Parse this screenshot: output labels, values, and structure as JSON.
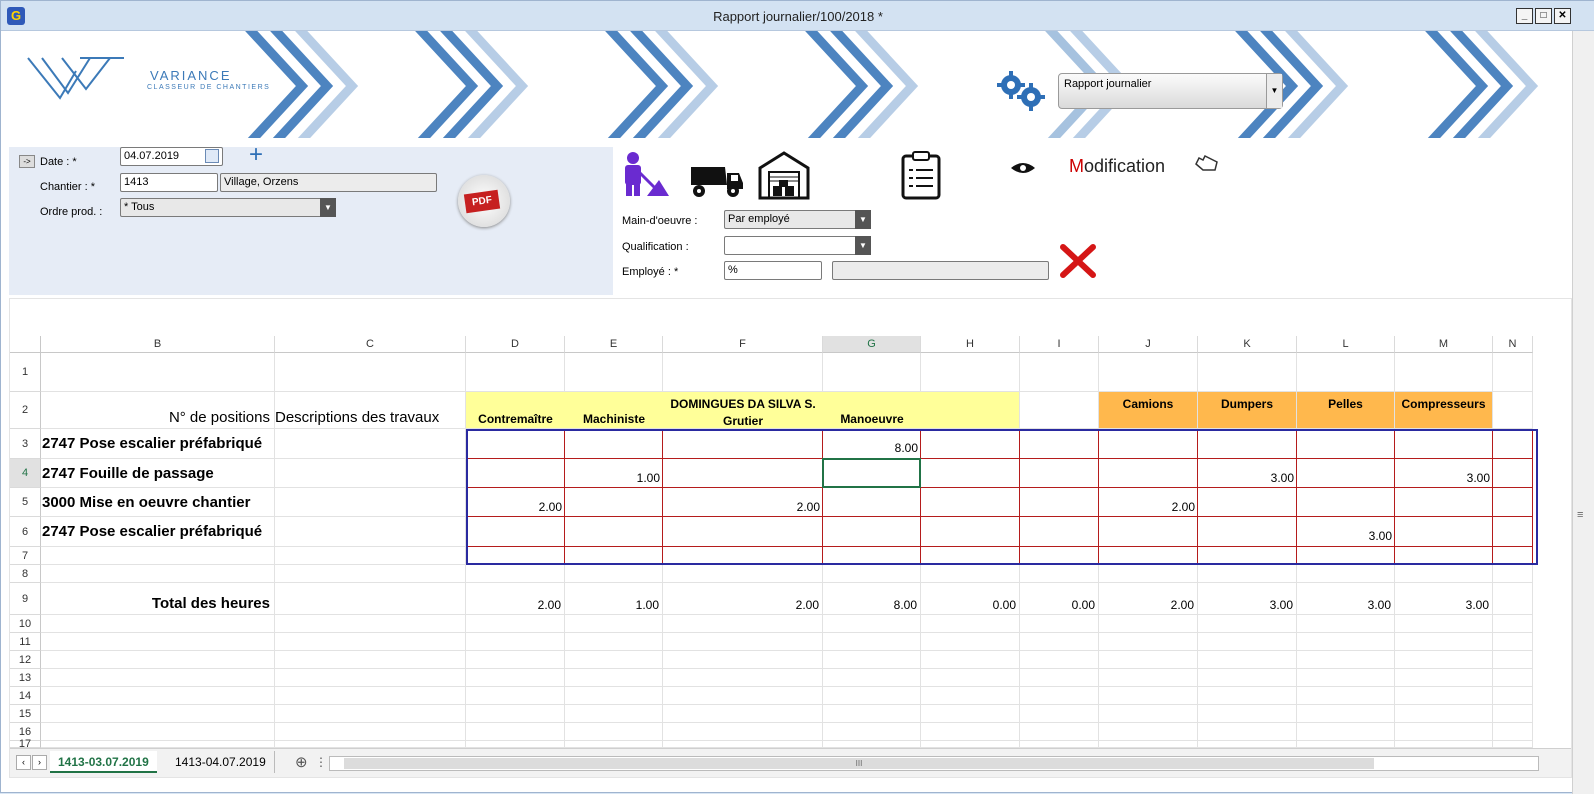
{
  "window": {
    "title": "Rapport journalier/100/2018 *",
    "app_icon": "app-logo-icon",
    "min": "_",
    "max": "□",
    "close": "✕"
  },
  "banner": {
    "logo_name": "VARIANCE",
    "logo_tag": "CLASSEUR DE CHANTIERS",
    "report_select": "Rapport journalier"
  },
  "filters": {
    "date_label": "Date : *",
    "date_value": "04.07.2019",
    "chantier_label": "Chantier : *",
    "chantier_code": "1413",
    "chantier_name": "Village, Orzens",
    "ordre_label": "Ordre prod. :",
    "ordre_value": "* Tous",
    "expand": "->",
    "add": "+",
    "pdf": "PDF"
  },
  "panel": {
    "mode_first": "M",
    "mode_rest": "odification",
    "mo_label": "Main-d'oeuvre :",
    "mo_value": "Par employé",
    "qual_label": "Qualification :",
    "qual_value": "",
    "emp_label": "Employé : *",
    "emp_code": "%",
    "emp_name": ""
  },
  "sheet": {
    "columns": [
      "B",
      "C",
      "D",
      "E",
      "F",
      "G",
      "H",
      "I",
      "J",
      "K",
      "L",
      "M",
      "N"
    ],
    "rows": [
      "1",
      "2",
      "3",
      "4",
      "5",
      "6",
      "7",
      "8",
      "9",
      "10",
      "11",
      "12",
      "13",
      "14",
      "15",
      "16",
      "17"
    ],
    "header_positions": "N° de positions",
    "header_desc": "Descriptions des travaux",
    "employee": "DOMINGUES DA SILVA S.",
    "emp_roles": [
      "Contremaître",
      "Machiniste",
      "Grutier",
      "Manoeuvre"
    ],
    "machines": [
      "Camions",
      "Dumpers",
      "Pelles",
      "Compresseurs"
    ],
    "positions": [
      "2747 Pose escalier préfabriqué",
      "2747 Fouille de passage",
      "3000 Mise en oeuvre chantier",
      "2747 Pose escalier préfabriqué"
    ],
    "values": {
      "g3": "8.00",
      "e4": "1.00",
      "k4": "3.00",
      "m4": "3.00",
      "d5": "2.00",
      "f5": "2.00",
      "j5": "2.00",
      "l6": "3.00"
    },
    "total_label": "Total des heures",
    "totals": [
      "2.00",
      "1.00",
      "2.00",
      "8.00",
      "0.00",
      "0.00",
      "2.00",
      "3.00",
      "3.00",
      "3.00"
    ]
  },
  "tabs": {
    "tab1": "1413-03.07.2019",
    "tab2": "1413-04.07.2019",
    "add": "⊕",
    "more": "⋮"
  },
  "colors": {
    "yellow": "#ffff99",
    "orange": "#ffb84d",
    "active": "#217346"
  }
}
